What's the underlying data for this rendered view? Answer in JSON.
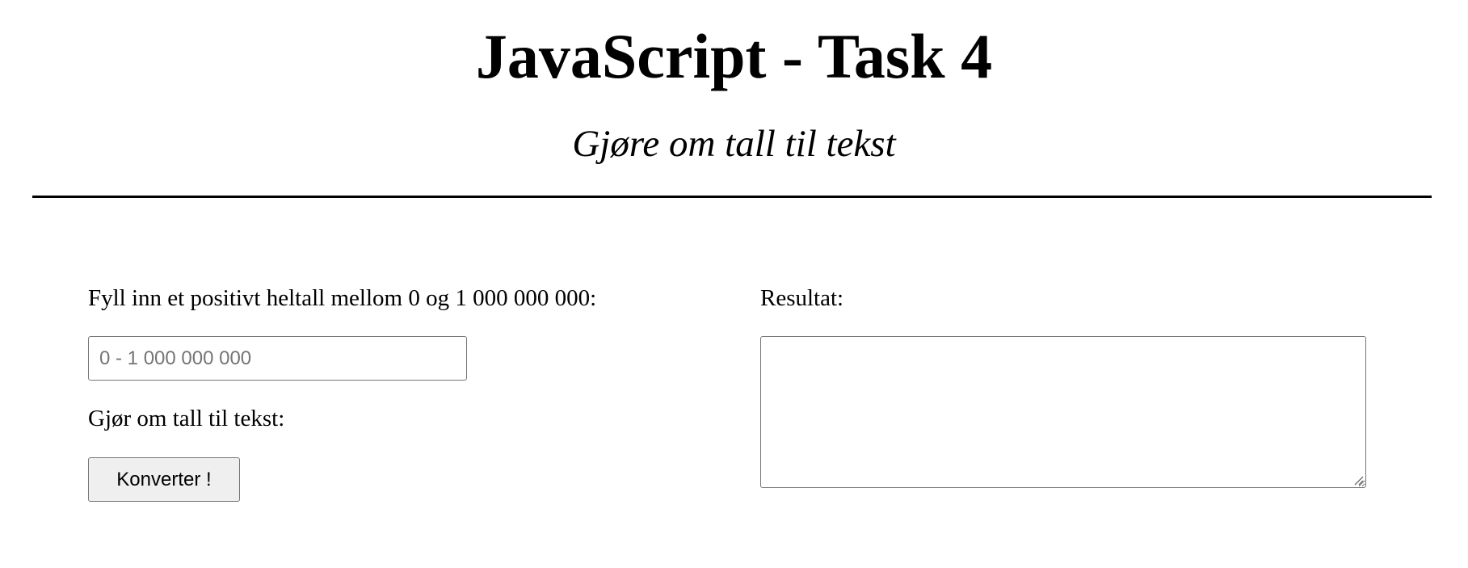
{
  "header": {
    "title": "JavaScript - Task 4",
    "subtitle": "Gjøre om tall til tekst"
  },
  "form": {
    "input_label": "Fyll inn et positivt heltall mellom 0 og 1 000 000 000:",
    "input_value": "",
    "input_placeholder": "0 - 1 000 000 000",
    "convert_label": "Gjør om tall til tekst:",
    "convert_button": "Konverter !"
  },
  "result": {
    "label": "Resultat:",
    "value": ""
  },
  "icons": {
    "resize_grip": "resize-grip-icon"
  }
}
